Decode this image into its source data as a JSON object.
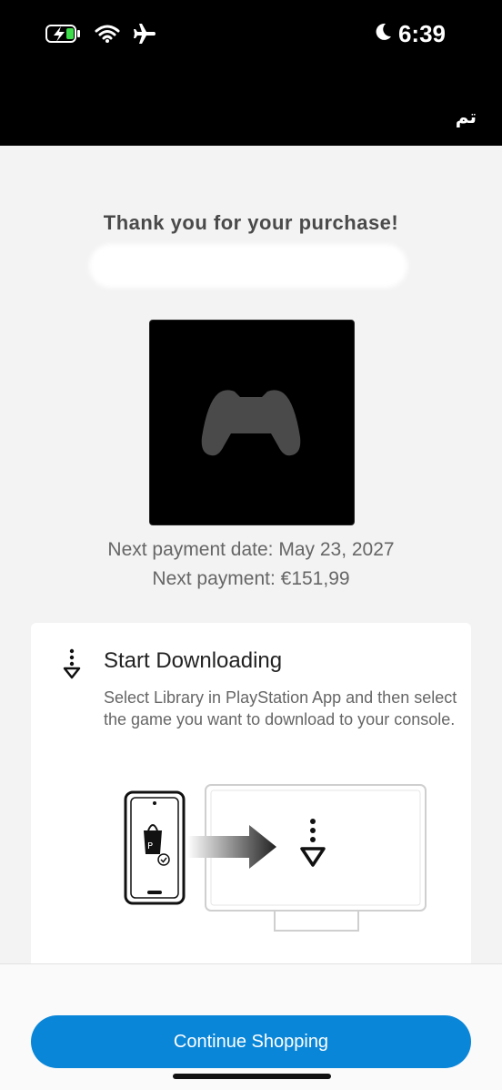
{
  "status_bar": {
    "time": "6:39",
    "icons": [
      "battery-charging-icon",
      "wifi-icon",
      "airplane-icon",
      "moon-icon"
    ]
  },
  "header": {
    "done_label": "تم"
  },
  "confirmation": {
    "title": "Thank you for your purchase!",
    "product_icon": "gamepad-icon",
    "next_payment_date": "Next payment date: May 23, 2027",
    "next_payment_amount": "Next payment: €151,99"
  },
  "download_card": {
    "icon": "download-arrow-icon",
    "title": "Start Downloading",
    "description": "Select Library in PlayStation App and then select the game you want to download to your console."
  },
  "footer": {
    "continue_label": "Continue Shopping"
  },
  "colors": {
    "accent": "#0a86d8",
    "statusbar": "#000000",
    "background": "#f3f3f3"
  }
}
